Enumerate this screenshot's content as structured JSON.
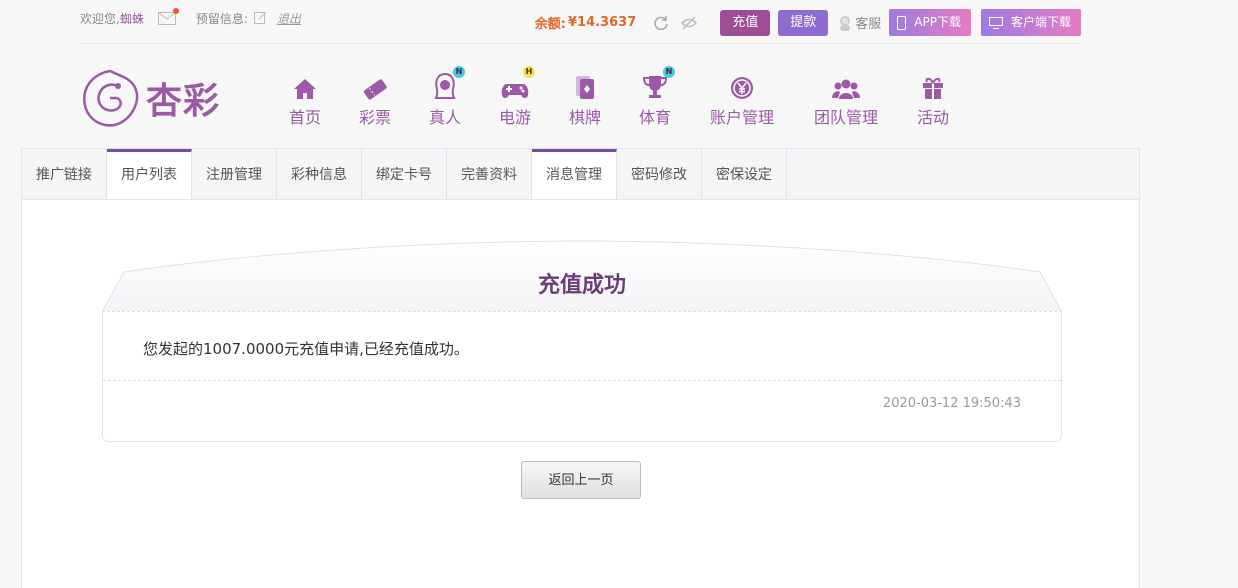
{
  "topbar": {
    "welcome": "欢迎您,",
    "username": "蜘蛛",
    "reserved_info_label": "预留信息:",
    "logout_label": "退出",
    "balance_label": "余额:",
    "balance_value": "¥14.3637",
    "recharge_label": "充值",
    "withdraw_label": "提款",
    "customer_service_label": "客服",
    "app_download_label": "APP下载",
    "client_download_label": "客户端下载"
  },
  "logo": {
    "text": "杏彩"
  },
  "nav": {
    "items": [
      {
        "label": "首页",
        "icon": "home-icon"
      },
      {
        "label": "彩票",
        "icon": "ticket-icon"
      },
      {
        "label": "真人",
        "icon": "live-dealer-icon",
        "badge": "N"
      },
      {
        "label": "电游",
        "icon": "gamepad-icon",
        "badge": "H"
      },
      {
        "label": "棋牌",
        "icon": "cards-icon"
      },
      {
        "label": "体育",
        "icon": "trophy-icon",
        "badge": "N"
      },
      {
        "label": "账户管理",
        "icon": "yen-icon"
      },
      {
        "label": "团队管理",
        "icon": "team-icon"
      },
      {
        "label": "活动",
        "icon": "gift-icon"
      }
    ]
  },
  "tabs": [
    "推广链接",
    "用户列表",
    "注册管理",
    "彩种信息",
    "绑定卡号",
    "完善资料",
    "消息管理",
    "密码修改",
    "密保设定"
  ],
  "message": {
    "title": "充值成功",
    "body": "您发起的1007.0000元充值申请,已经充值成功。",
    "time": "2020-03-12 19:50:43"
  },
  "back_button_label": "返回上一页",
  "colors": {
    "brand": "#9a5aa6",
    "accent": "#e0662a",
    "title": "#6b3f76"
  }
}
